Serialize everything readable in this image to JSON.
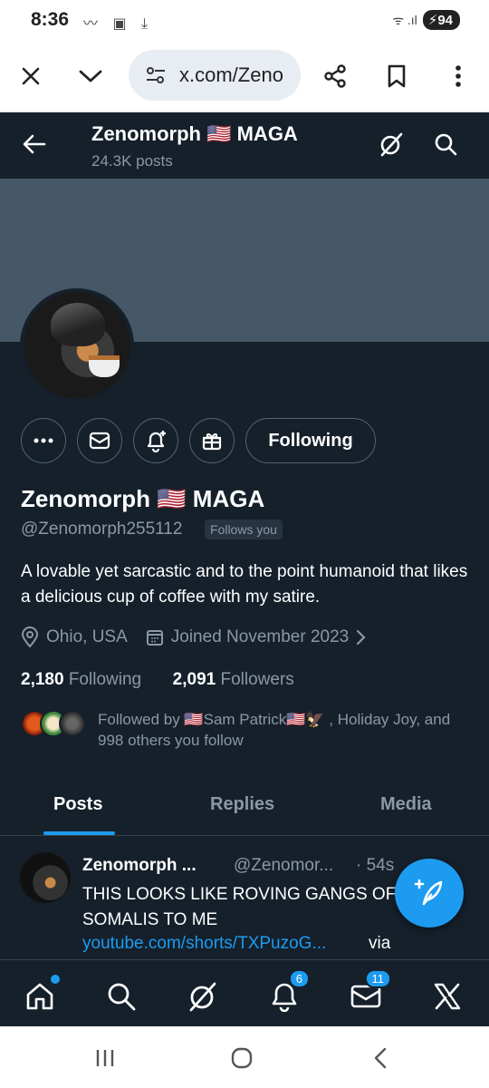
{
  "status_bar": {
    "time": "8:36",
    "battery": "94"
  },
  "browser": {
    "url": "x.com/Zeno"
  },
  "header": {
    "name": "Zenomorph 🇺🇸 MAGA",
    "posts": "24.3K posts"
  },
  "profile": {
    "following_button": "Following",
    "name": "Zenomorph 🇺🇸 MAGA",
    "handle": "@Zenomorph255112",
    "follows_you": "Follows you",
    "bio": "A lovable yet sarcastic and to the point humanoid that likes a delicious cup of coffee with my satire.",
    "location": "Ohio, USA",
    "joined": "Joined November 2023",
    "following_count": "2,180",
    "following_label": "Following",
    "followers_count": "2,091",
    "followers_label": "Followers",
    "followed_by": "Followed by 🇺🇸Sam Patrick🇺🇸🦅 , Holiday Joy, and 998 others you follow"
  },
  "tabs": [
    "Posts",
    "Replies",
    "Media"
  ],
  "tweet": {
    "name": "Zenomorph ...",
    "handle": "@Zenomor...",
    "time": "· 54s",
    "text": "THIS LOOKS LIKE ROVING GANGS OF SOMALIS TO ME",
    "link": "youtube.com/shorts/TXPuzoG...",
    "via": "via"
  },
  "bottom_nav": {
    "notifications_badge": "6",
    "messages_badge": "11"
  },
  "colors": {
    "background": "#15202b",
    "accent": "#1d9bf0",
    "muted": "#8b98a5",
    "banner": "#465867"
  }
}
